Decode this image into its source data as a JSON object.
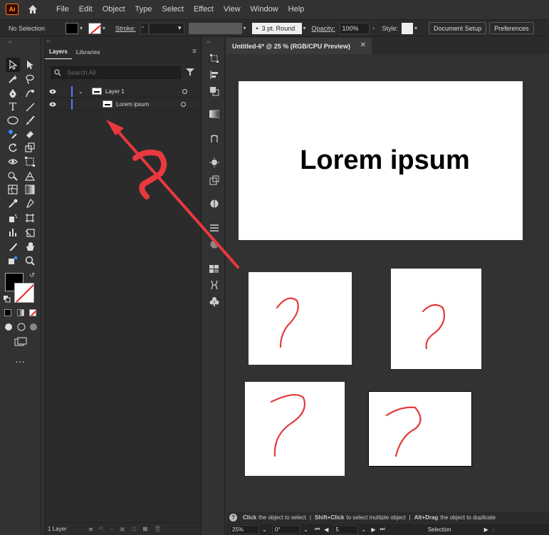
{
  "app": {
    "logo_text": "Ai"
  },
  "menu": {
    "items": [
      "File",
      "Edit",
      "Object",
      "Type",
      "Select",
      "Effect",
      "View",
      "Window",
      "Help"
    ]
  },
  "control_bar": {
    "selection": "No Selection",
    "stroke_label": "Stroke:",
    "brush": "3 pt. Round",
    "opacity_label": "Opacity:",
    "opacity_value": "100%",
    "style_label": "Style:",
    "doc_setup": "Document Setup",
    "preferences": "Preferences"
  },
  "layers_panel": {
    "tabs": [
      "Layers",
      "Libraries"
    ],
    "search_placeholder": "Search All",
    "layers": [
      {
        "name": "Layer 1",
        "color": "#4f7bff"
      },
      {
        "name": "Lorem ipsum",
        "color": "#4f7bff"
      }
    ],
    "footer": "1 Layer"
  },
  "document": {
    "tab_title": "Untitled-6* @ 25 % (RGB/CPU Preview)",
    "headline": "Lorem ipsum"
  },
  "hint": {
    "part1_bold": "Click",
    "part1": "the object to select",
    "part2_bold": "Shift+Click",
    "part2": "to select multiple object",
    "part3_bold": "Alt+Drag",
    "part3": "the object to duplicate"
  },
  "status": {
    "zoom": "25%",
    "rotation": "0°",
    "artboard": "5",
    "mode": "Selection"
  },
  "colors": {
    "accent": "#e8393f",
    "layer_color": "#4f7bff"
  }
}
